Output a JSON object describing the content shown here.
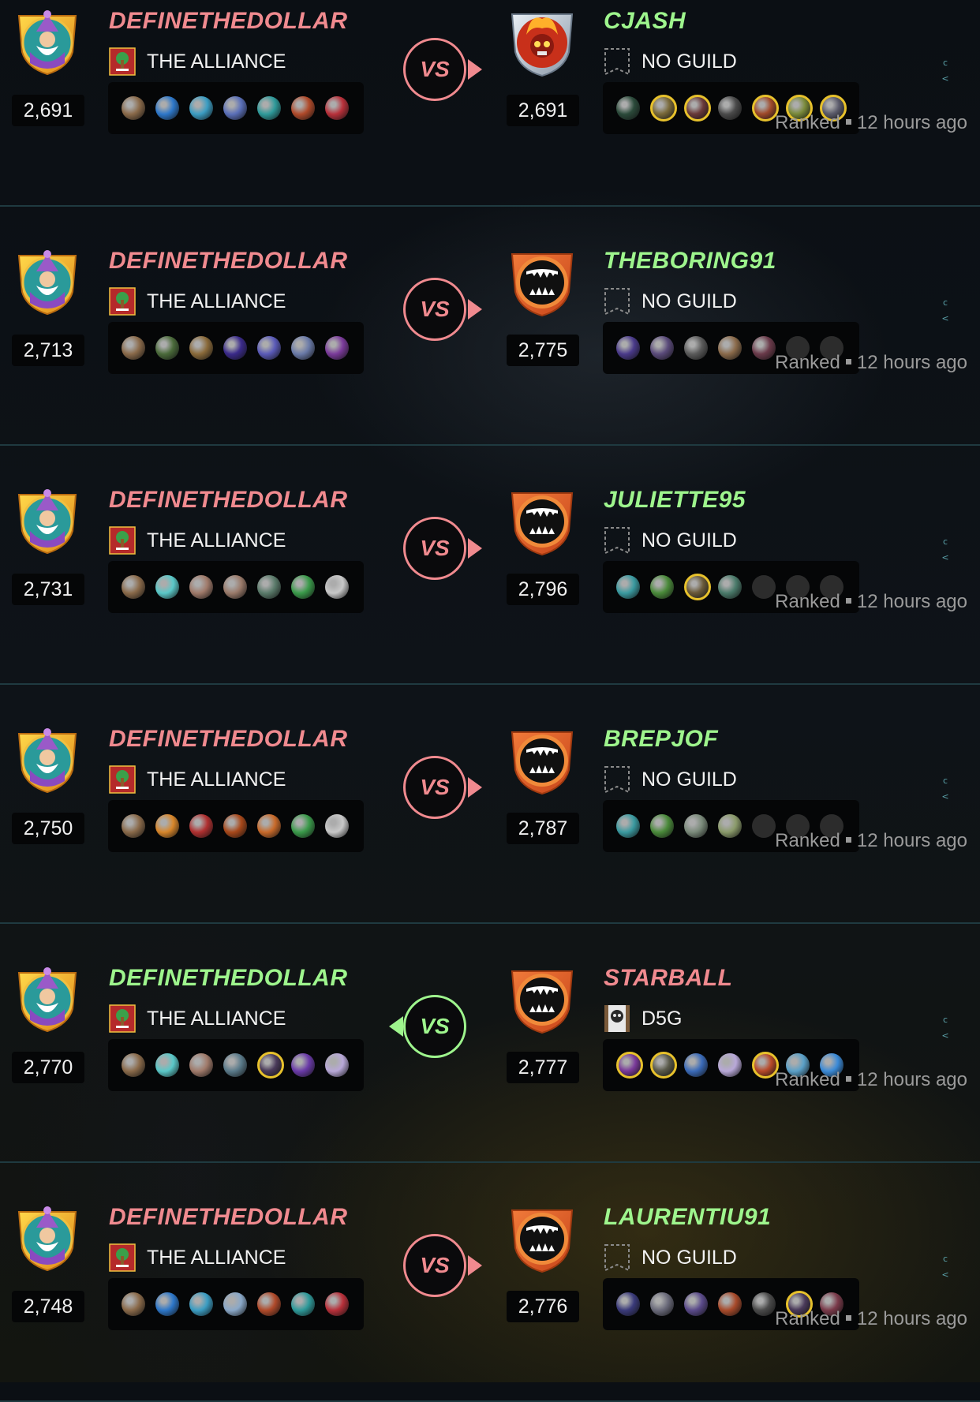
{
  "colors": {
    "win": "#9ef58d",
    "lose": "#f08a8f",
    "gold_border": "#e7c12c"
  },
  "battles": [
    {
      "player": {
        "name": "DEFINETHEDOLLAR",
        "result": "lose",
        "guild": "THE ALLIANCE",
        "guild_icon": "tree-banner-icon",
        "rating": "2,691",
        "avatar": "wizard-shield-icon",
        "cards": [
          {
            "c": "#8a6a4a"
          },
          {
            "c": "#2d77c9"
          },
          {
            "c": "#3b9dc3"
          },
          {
            "c": "#5a6fb8"
          },
          {
            "c": "#2e9a9a"
          },
          {
            "c": "#b04a2a"
          },
          {
            "c": "#b8303a"
          }
        ]
      },
      "opponent": {
        "name": "CJASH",
        "result": "win",
        "guild": "NO GUILD",
        "guild_icon": "empty-banner-icon",
        "rating": "2,691",
        "avatar": "fire-skull-silver-shield-icon",
        "cards": [
          {
            "c": "#2b4a3a"
          },
          {
            "c": "#7a6a3a",
            "gold": true
          },
          {
            "c": "#6a3a3a",
            "gold": true
          },
          {
            "c": "#4a4a4a"
          },
          {
            "c": "#a04a2a",
            "gold": true
          },
          {
            "c": "#7a8a3a",
            "gold": true
          },
          {
            "c": "#5a5a6a",
            "gold": true
          }
        ]
      },
      "winner_side": "right",
      "mode": "Ranked",
      "time": "12 hours ago"
    },
    {
      "player": {
        "name": "DEFINETHEDOLLAR",
        "result": "lose",
        "guild": "THE ALLIANCE",
        "guild_icon": "tree-banner-icon",
        "rating": "2,713",
        "avatar": "wizard-shield-icon",
        "cards": [
          {
            "c": "#8a6a4a"
          },
          {
            "c": "#4a6a3a"
          },
          {
            "c": "#8a6a3a"
          },
          {
            "c": "#3a2a8a"
          },
          {
            "c": "#5a5ab8"
          },
          {
            "c": "#6a7aa8"
          },
          {
            "c": "#7a3a9a"
          }
        ]
      },
      "opponent": {
        "name": "THEBORING91",
        "result": "win",
        "guild": "NO GUILD",
        "guild_icon": "empty-banner-icon",
        "rating": "2,775",
        "avatar": "fangs-orange-shield-icon",
        "cards": [
          {
            "c": "#4a3a8a"
          },
          {
            "c": "#5a4a7a"
          },
          {
            "c": "#5a5a5a"
          },
          {
            "c": "#8a6a4a"
          },
          {
            "c": "#6a3a4a"
          },
          {
            "c": "#2c2c2c",
            "empty": true
          },
          {
            "c": "#2c2c2c",
            "empty": true
          }
        ]
      },
      "winner_side": "right",
      "mode": "Ranked",
      "time": "12 hours ago"
    },
    {
      "player": {
        "name": "DEFINETHEDOLLAR",
        "result": "lose",
        "guild": "THE ALLIANCE",
        "guild_icon": "tree-banner-icon",
        "rating": "2,731",
        "avatar": "wizard-shield-icon",
        "cards": [
          {
            "c": "#8a6a4a"
          },
          {
            "c": "#5ac8c8"
          },
          {
            "c": "#a07a6a"
          },
          {
            "c": "#9a7a6a"
          },
          {
            "c": "#5a7a6a"
          },
          {
            "c": "#3a9a4a"
          },
          {
            "c": "#c8c8c8"
          }
        ]
      },
      "opponent": {
        "name": "JULIETTE95",
        "result": "win",
        "guild": "NO GUILD",
        "guild_icon": "empty-banner-icon",
        "rating": "2,796",
        "avatar": "fangs-orange-shield-icon",
        "cards": [
          {
            "c": "#3a9aa0"
          },
          {
            "c": "#4a8a3a"
          },
          {
            "c": "#6a5a3a",
            "gold": true
          },
          {
            "c": "#4a7a6a"
          },
          {
            "c": "#2c2c2c",
            "empty": true
          },
          {
            "c": "#2c2c2c",
            "empty": true
          },
          {
            "c": "#2c2c2c",
            "empty": true
          }
        ]
      },
      "winner_side": "right",
      "mode": "Ranked",
      "time": "12 hours ago"
    },
    {
      "player": {
        "name": "DEFINETHEDOLLAR",
        "result": "lose",
        "guild": "THE ALLIANCE",
        "guild_icon": "tree-banner-icon",
        "rating": "2,750",
        "avatar": "wizard-shield-icon",
        "cards": [
          {
            "c": "#8a6a4a"
          },
          {
            "c": "#d8862a"
          },
          {
            "c": "#b03030"
          },
          {
            "c": "#a8481a"
          },
          {
            "c": "#c86a2a"
          },
          {
            "c": "#3a9a4a"
          },
          {
            "c": "#c8c8c8"
          }
        ]
      },
      "opponent": {
        "name": "BREPJOF",
        "result": "win",
        "guild": "NO GUILD",
        "guild_icon": "empty-banner-icon",
        "rating": "2,787",
        "avatar": "fangs-orange-shield-icon",
        "cards": [
          {
            "c": "#3a9aa0"
          },
          {
            "c": "#4a8a3a"
          },
          {
            "c": "#7a8a7a"
          },
          {
            "c": "#8a9a6a"
          },
          {
            "c": "#2c2c2c",
            "empty": true
          },
          {
            "c": "#2c2c2c",
            "empty": true
          },
          {
            "c": "#2c2c2c",
            "empty": true
          }
        ]
      },
      "winner_side": "right",
      "mode": "Ranked",
      "time": "12 hours ago"
    },
    {
      "player": {
        "name": "DEFINETHEDOLLAR",
        "result": "win",
        "guild": "THE ALLIANCE",
        "guild_icon": "tree-banner-icon",
        "rating": "2,770",
        "avatar": "wizard-shield-icon",
        "cards": [
          {
            "c": "#8a6a4a"
          },
          {
            "c": "#5ac8c8"
          },
          {
            "c": "#a07a6a"
          },
          {
            "c": "#5a7a8a"
          },
          {
            "c": "#4a3a5a",
            "gold": true
          },
          {
            "c": "#6a3aa8"
          },
          {
            "c": "#b8a8d8"
          }
        ]
      },
      "opponent": {
        "name": "STARBALL",
        "result": "lose",
        "guild": "D5G",
        "guild_icon": "skull-banner-icon",
        "rating": "2,777",
        "avatar": "fangs-orange-shield-icon",
        "cards": [
          {
            "c": "#7a3a9a",
            "gold": true
          },
          {
            "c": "#5a5a4a",
            "gold": true
          },
          {
            "c": "#3a6ab8"
          },
          {
            "c": "#b8a8d8"
          },
          {
            "c": "#b84a2a",
            "gold": true
          },
          {
            "c": "#5aa0c8"
          },
          {
            "c": "#3a8ad8"
          }
        ]
      },
      "winner_side": "left",
      "mode": "Ranked",
      "time": "12 hours ago"
    },
    {
      "player": {
        "name": "DEFINETHEDOLLAR",
        "result": "lose",
        "guild": "THE ALLIANCE",
        "guild_icon": "tree-banner-icon",
        "rating": "2,748",
        "avatar": "wizard-shield-icon",
        "cards": [
          {
            "c": "#8a6a4a"
          },
          {
            "c": "#2d77c9"
          },
          {
            "c": "#3b9dc3"
          },
          {
            "c": "#8aa8c8"
          },
          {
            "c": "#b04a2a"
          },
          {
            "c": "#2e9a9a"
          },
          {
            "c": "#b8303a"
          }
        ]
      },
      "opponent": {
        "name": "LAURENTIU91",
        "result": "win",
        "guild": "NO GUILD",
        "guild_icon": "empty-banner-icon",
        "rating": "2,776",
        "avatar": "fangs-orange-shield-icon",
        "cards": [
          {
            "c": "#3a3a7a"
          },
          {
            "c": "#6a6a7a"
          },
          {
            "c": "#5a4a8a"
          },
          {
            "c": "#a84a2a"
          },
          {
            "c": "#4a4a4a"
          },
          {
            "c": "#4a3a5a",
            "gold": true
          },
          {
            "c": "#7a3a4a"
          }
        ]
      },
      "winner_side": "right",
      "mode": "Ranked",
      "time": "12 hours ago"
    }
  ]
}
